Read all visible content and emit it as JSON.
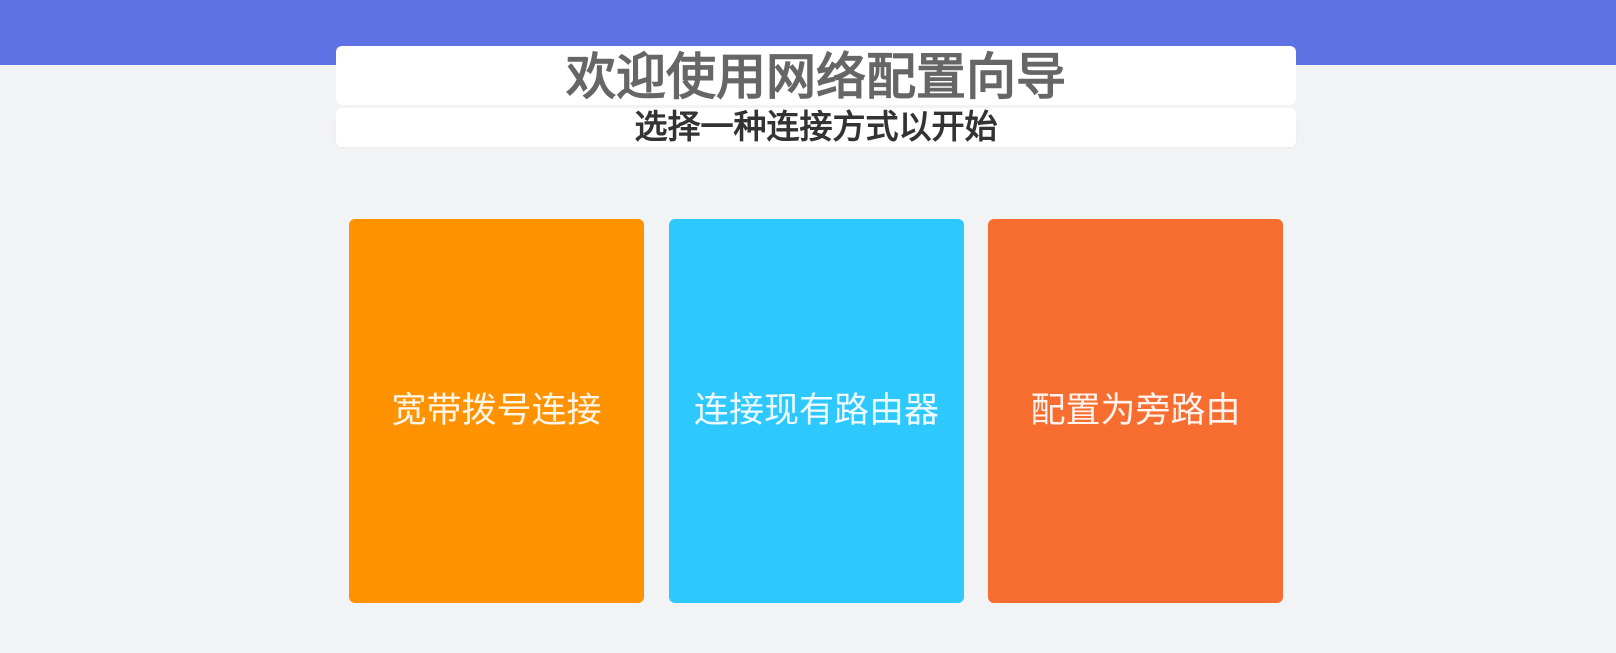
{
  "header": {
    "title": "欢迎使用网络配置向导",
    "subtitle": "选择一种连接方式以开始"
  },
  "options": [
    {
      "label": "宽带拨号连接",
      "color": "#ff9200"
    },
    {
      "label": "连接现有路由器",
      "color": "#2cc8fe"
    },
    {
      "label": "配置为旁路由",
      "color": "#f76d2f"
    }
  ],
  "theme": {
    "header_band": "#5f72e3",
    "background": "#f2f3f5"
  }
}
